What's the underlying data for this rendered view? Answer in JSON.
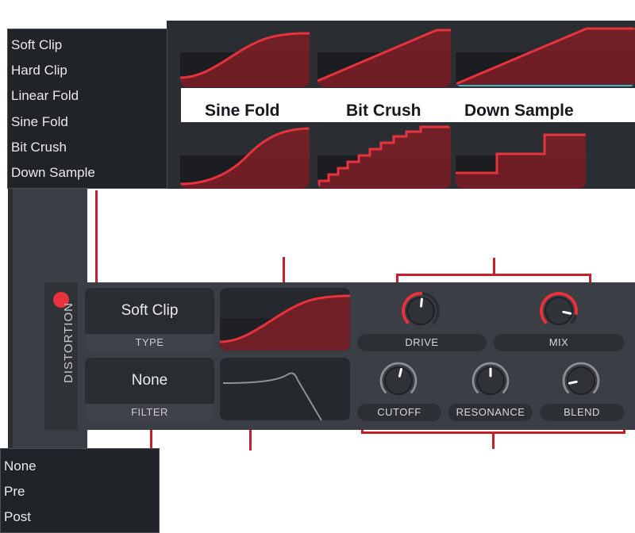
{
  "type_menu": {
    "items": [
      "Soft Clip",
      "Hard Clip",
      "Linear Fold",
      "Sine Fold",
      "Bit Crush",
      "Down Sample"
    ]
  },
  "previews": {
    "captions": [
      "Sine Fold",
      "Bit Crush",
      "Down Sample"
    ]
  },
  "distortion": {
    "title": "DISTORTION",
    "type_value": "Soft Clip",
    "type_label": "TYPE",
    "filter_value": "None",
    "filter_label": "FILTER",
    "knobs": {
      "drive": {
        "label": "DRIVE",
        "value": 0.52
      },
      "mix": {
        "label": "MIX",
        "value": 0.88
      },
      "cutoff": {
        "label": "CUTOFF",
        "value": 0.55
      },
      "resonance": {
        "label": "RESONANCE",
        "value": 0.5
      },
      "blend": {
        "label": "BLEND",
        "value": 0.12
      }
    }
  },
  "filter_menu": {
    "items": [
      "None",
      "Pre",
      "Post"
    ]
  },
  "colors": {
    "accent": "#e8323d",
    "panel": "#3b3e44",
    "menu": "#202327"
  }
}
